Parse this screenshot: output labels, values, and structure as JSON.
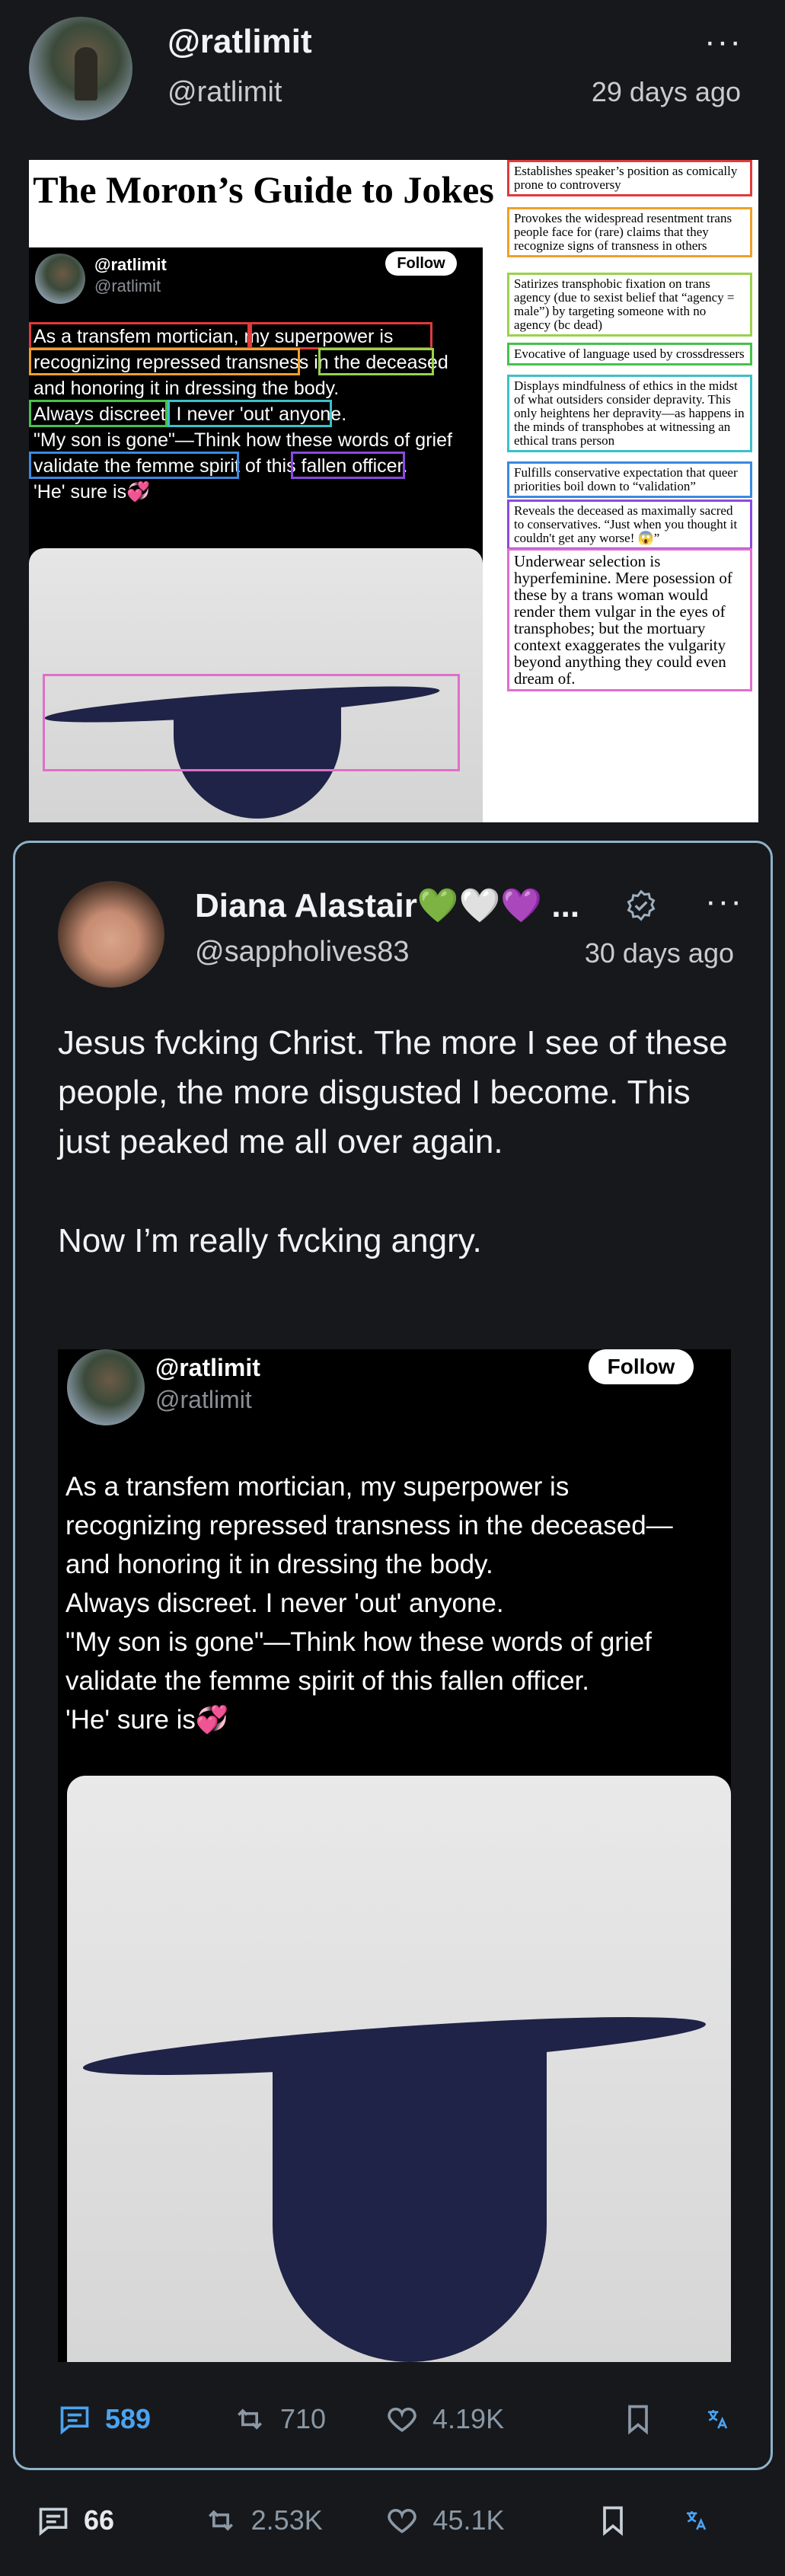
{
  "post": {
    "display_name": "@ratlimit",
    "handle": "@ratlimit",
    "timestamp": "29 days ago",
    "more_label": "···"
  },
  "guide_image": {
    "title": "The Moron’s Guide to Jokes",
    "tweet_name": "@ratlimit",
    "tweet_handle": "@ratlimit",
    "follow_label": "Follow",
    "tweet_text": "As a transfem mortician, my superpower is\nrecognizing repressed transness in the deceased\nand honoring it in dressing the body.\nAlways discreet. I never 'out' anyone.\n\"My son is gone\"—Think how these words of grief\nvalidate the femme spirit of this fallen officer.\n'He' sure is💞",
    "annotations": [
      {
        "text": "Establishes speaker’s position as comically prone to controversy",
        "color": "#e03a3a"
      },
      {
        "text": "Provokes the widespread resentment trans people face for (rare) claims that they recognize signs of transness in others",
        "color": "#f0a028"
      },
      {
        "text": "Satirizes transphobic fixation on trans agency (due to sexist belief that “agency = male”) by targeting someone with no agency (bc dead)",
        "color": "#9ad24a"
      },
      {
        "text": "Evocative of language used by crossdressers",
        "color": "#46c24a"
      },
      {
        "text": "Displays mindfulness of ethics in the midst of what outsiders consider depravity. This only heightens her depravity—as happens in the minds of transphobes at witnessing an ethical trans person",
        "color": "#3cc0c8"
      },
      {
        "text": "Fulfills conservative expectation that queer priorities boil down to “validation”",
        "color": "#3a8ae0"
      },
      {
        "text": "Reveals the deceased as maximally sacred to conservatives. “Just when you thought it couldn't get any worse! 😱”",
        "color": "#8a4ae0"
      },
      {
        "text": "Underwear selection is hyperfeminine. Mere posession of these by a trans woman would render them vulgar in the eyes of transphobes; but the mortuary context exaggerates the vulgarity beyond anything they could even dream of.",
        "color": "#e06fc8"
      }
    ]
  },
  "quote": {
    "display_name": "Diana Alastair💚🤍💜 ...",
    "handle": "@sappholives83",
    "timestamp": "30 days ago",
    "more_label": "···",
    "body": "Jesus fvcking Christ. The more I see of these people, the more disgusted I become. This just peaked me all over again.\n\nNow I’m really fvcking angry.",
    "embedded": {
      "name": "@ratlimit",
      "handle": "@ratlimit",
      "follow_label": "Follow",
      "text": "As a transfem mortician, my superpower is\nrecognizing repressed transness in the deceased—\nand honoring it in dressing the body.\nAlways discreet. I never 'out' anyone.\n\"My son is gone\"—Think how these words of grief\nvalidate the femme spirit of this fallen officer.\n'He' sure is💞"
    },
    "actions": {
      "replies": "589",
      "reposts": "710",
      "likes": "4.19K"
    }
  },
  "actions": {
    "replies": "66",
    "reposts": "2.53K",
    "likes": "45.1K"
  },
  "colors": {
    "background": "#16181c",
    "card_border": "#8fb2c8",
    "accent_blue": "#4aa3f0",
    "muted": "#8b98a5"
  }
}
